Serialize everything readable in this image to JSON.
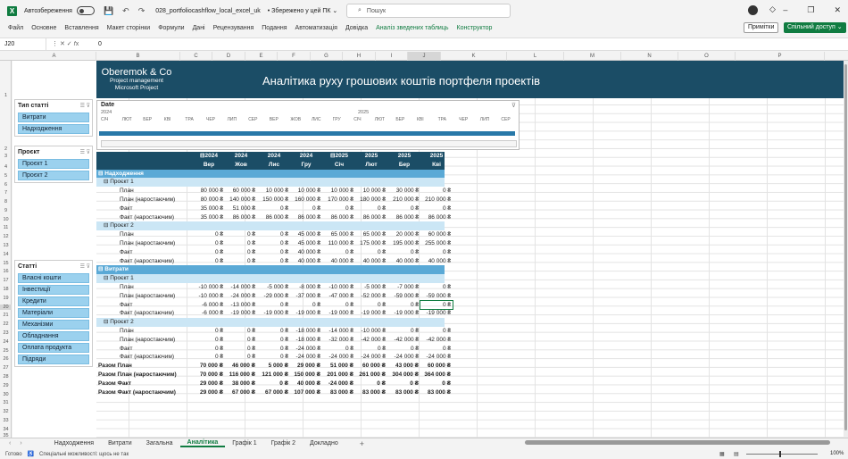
{
  "titlebar": {
    "autosave_label": "Автозбереження",
    "file_name": "028_portfoliocashflow_local_excel_uk",
    "saved_state": "• Збережено у цей ПК ⌄",
    "search_placeholder": "Пошук"
  },
  "menu": [
    "Файл",
    "Основне",
    "Вставлення",
    "Макет сторінки",
    "Формули",
    "Дані",
    "Рецензування",
    "Подання",
    "Автоматизація",
    "Довідка"
  ],
  "menu_green": [
    "Аналіз зведених таблиць",
    "Конструктор"
  ],
  "comments_label": "Примітки",
  "share_label": "Спільний доступ ⌄",
  "formula_bar": {
    "name_box": "J20",
    "value": "0"
  },
  "columns": [
    "A",
    "B",
    "C",
    "D",
    "E",
    "F",
    "G",
    "H",
    "I",
    "J",
    "K",
    "L",
    "M",
    "N",
    "O",
    "P"
  ],
  "rows": [
    "1",
    "2",
    "3",
    "4",
    "5",
    "6",
    "7",
    "8",
    "9",
    "10",
    "11",
    "12",
    "13",
    "14",
    "15",
    "16",
    "17",
    "18",
    "19",
    "20",
    "21",
    "22",
    "23",
    "24",
    "25",
    "26",
    "27",
    "28",
    "29",
    "30",
    "31",
    "32",
    "33",
    "34",
    "35"
  ],
  "logo": {
    "name": "Oberemok & Co",
    "line1": "Project management",
    "line2": "Microsoft Project"
  },
  "report_title": "Аналітика руху грошових коштів портфеля проектів",
  "slicers": [
    {
      "title": "Тип статті",
      "items": [
        "Витрати",
        "Надходження"
      ]
    },
    {
      "title": "Проєкт",
      "items": [
        "Проєкт 1",
        "Проєкт 2"
      ]
    },
    {
      "title": "Статті",
      "items": [
        "Власні кошти",
        "Інвестиції",
        "Кредити",
        "Матеріали",
        "Механізми",
        "Обладнання",
        "Оплата продукта",
        "Підряди"
      ]
    }
  ],
  "timeline": {
    "title": "Date",
    "years": [
      "2024",
      "2025"
    ],
    "months": [
      "СІЧ",
      "ЛЮТ",
      "БЕР",
      "КВІ",
      "ТРА",
      "ЧЕР",
      "ЛИП",
      "СЕР",
      "ВЕР",
      "ЖОВ",
      "ЛИС",
      "ГРУ",
      "СІЧ",
      "ЛЮТ",
      "БЕР",
      "КВІ",
      "ТРА",
      "ЧЕР",
      "ЛИП",
      "СЕР"
    ]
  },
  "pivot": {
    "years": [
      "⊟2024",
      "2024",
      "2024",
      "2024",
      "⊟2025",
      "2025",
      "2025",
      "2025"
    ],
    "months": [
      "Вер",
      "Жов",
      "Лис",
      "Гру",
      "Січ",
      "Лют",
      "Бер",
      "Кві"
    ],
    "rows": [
      {
        "type": "cat",
        "label": "⊟ Надходження",
        "values": []
      },
      {
        "type": "proj",
        "label": "⊟ Проєкт 1",
        "values": []
      },
      {
        "type": "line",
        "label": "План",
        "values": [
          "80 000 ₴",
          "60 000 ₴",
          "10 000 ₴",
          "10 000 ₴",
          "10 000 ₴",
          "10 000 ₴",
          "30 000 ₴",
          "0 ₴"
        ]
      },
      {
        "type": "line",
        "label": "План (наростаючим)",
        "values": [
          "80 000 ₴",
          "140 000 ₴",
          "150 000 ₴",
          "160 000 ₴",
          "170 000 ₴",
          "180 000 ₴",
          "210 000 ₴",
          "210 000 ₴"
        ]
      },
      {
        "type": "line",
        "label": "Факт",
        "values": [
          "35 000 ₴",
          "51 000 ₴",
          "0 ₴",
          "0 ₴",
          "0 ₴",
          "0 ₴",
          "0 ₴",
          "0 ₴"
        ]
      },
      {
        "type": "line",
        "label": "Факт (наростаючим)",
        "values": [
          "35 000 ₴",
          "86 000 ₴",
          "86 000 ₴",
          "86 000 ₴",
          "86 000 ₴",
          "86 000 ₴",
          "86 000 ₴",
          "86 000 ₴"
        ]
      },
      {
        "type": "proj",
        "label": "⊟ Проєкт 2",
        "values": []
      },
      {
        "type": "line",
        "label": "План",
        "values": [
          "0 ₴",
          "0 ₴",
          "0 ₴",
          "45 000 ₴",
          "65 000 ₴",
          "65 000 ₴",
          "20 000 ₴",
          "60 000 ₴"
        ]
      },
      {
        "type": "line",
        "label": "План (наростаючим)",
        "values": [
          "0 ₴",
          "0 ₴",
          "0 ₴",
          "45 000 ₴",
          "110 000 ₴",
          "175 000 ₴",
          "195 000 ₴",
          "255 000 ₴"
        ]
      },
      {
        "type": "line",
        "label": "Факт",
        "values": [
          "0 ₴",
          "0 ₴",
          "0 ₴",
          "40 000 ₴",
          "0 ₴",
          "0 ₴",
          "0 ₴",
          "0 ₴"
        ]
      },
      {
        "type": "line",
        "label": "Факт (наростаючим)",
        "values": [
          "0 ₴",
          "0 ₴",
          "0 ₴",
          "40 000 ₴",
          "40 000 ₴",
          "40 000 ₴",
          "40 000 ₴",
          "40 000 ₴"
        ]
      },
      {
        "type": "cat",
        "label": "⊟ Витрати",
        "values": []
      },
      {
        "type": "proj",
        "label": "⊟ Проєкт 1",
        "values": []
      },
      {
        "type": "line",
        "label": "План",
        "values": [
          "-10 000 ₴",
          "-14 000 ₴",
          "-5 000 ₴",
          "-8 000 ₴",
          "-10 000 ₴",
          "-5 000 ₴",
          "-7 000 ₴",
          "0 ₴"
        ]
      },
      {
        "type": "line",
        "label": "План (наростаючим)",
        "values": [
          "-10 000 ₴",
          "-24 000 ₴",
          "-29 000 ₴",
          "-37 000 ₴",
          "-47 000 ₴",
          "-52 000 ₴",
          "-59 000 ₴",
          "-59 000 ₴"
        ]
      },
      {
        "type": "line",
        "label": "Факт",
        "values": [
          "-6 000 ₴",
          "-13 000 ₴",
          "0 ₴",
          "0 ₴",
          "0 ₴",
          "0 ₴",
          "0 ₴",
          "0 ₴"
        ]
      },
      {
        "type": "line",
        "label": "Факт (наростаючим)",
        "values": [
          "-6 000 ₴",
          "-19 000 ₴",
          "-19 000 ₴",
          "-19 000 ₴",
          "-19 000 ₴",
          "-19 000 ₴",
          "-19 000 ₴",
          "-19 000 ₴"
        ]
      },
      {
        "type": "proj",
        "label": "⊟ Проєкт 2",
        "values": []
      },
      {
        "type": "line",
        "label": "План",
        "values": [
          "0 ₴",
          "0 ₴",
          "0 ₴",
          "-18 000 ₴",
          "-14 000 ₴",
          "-10 000 ₴",
          "0 ₴",
          "0 ₴"
        ]
      },
      {
        "type": "line",
        "label": "План (наростаючим)",
        "values": [
          "0 ₴",
          "0 ₴",
          "0 ₴",
          "-18 000 ₴",
          "-32 000 ₴",
          "-42 000 ₴",
          "-42 000 ₴",
          "-42 000 ₴"
        ]
      },
      {
        "type": "line",
        "label": "Факт",
        "values": [
          "0 ₴",
          "0 ₴",
          "0 ₴",
          "-24 000 ₴",
          "0 ₴",
          "0 ₴",
          "0 ₴",
          "0 ₴"
        ]
      },
      {
        "type": "line",
        "label": "Факт (наростаючим)",
        "values": [
          "0 ₴",
          "0 ₴",
          "0 ₴",
          "-24 000 ₴",
          "-24 000 ₴",
          "-24 000 ₴",
          "-24 000 ₴",
          "-24 000 ₴"
        ]
      },
      {
        "type": "tot",
        "label": "Разом План",
        "values": [
          "70 000 ₴",
          "46 000 ₴",
          "5 000 ₴",
          "29 000 ₴",
          "51 000 ₴",
          "60 000 ₴",
          "43 000 ₴",
          "60 000 ₴"
        ]
      },
      {
        "type": "tot",
        "label": "Разом План (наростаючим)",
        "values": [
          "70 000 ₴",
          "116 000 ₴",
          "121 000 ₴",
          "150 000 ₴",
          "201 000 ₴",
          "261 000 ₴",
          "304 000 ₴",
          "364 000 ₴"
        ]
      },
      {
        "type": "tot",
        "label": "Разом Факт",
        "values": [
          "29 000 ₴",
          "38 000 ₴",
          "0 ₴",
          "40 000 ₴",
          "-24 000 ₴",
          "0 ₴",
          "0 ₴",
          "0 ₴"
        ]
      },
      {
        "type": "tot",
        "label": "Разом Факт (наростаючим)",
        "values": [
          "29 000 ₴",
          "67 000 ₴",
          "67 000 ₴",
          "107 000 ₴",
          "83 000 ₴",
          "83 000 ₴",
          "83 000 ₴",
          "83 000 ₴"
        ]
      }
    ]
  },
  "sheets": [
    "Надходження",
    "Витрати",
    "Загальна",
    "Аналітика",
    "Графік 1",
    "Графік 2",
    "Докладно"
  ],
  "active_sheet": "Аналітика",
  "status": {
    "ready": "Готово",
    "accessibility": "Спеціальні можливості: щось не так",
    "zoom": "100%"
  }
}
